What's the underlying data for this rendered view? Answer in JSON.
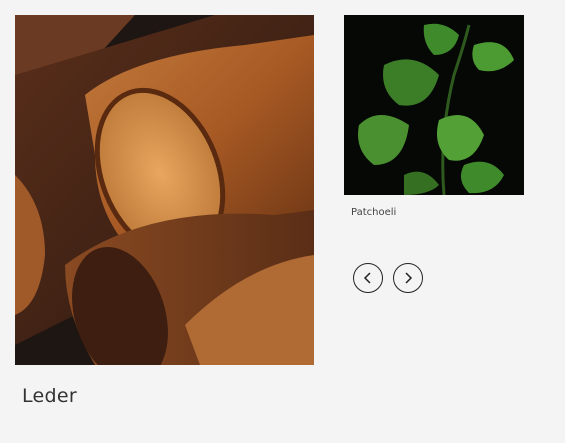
{
  "cards": [
    {
      "title": "Leder",
      "image": "leather-rolls-image"
    },
    {
      "title": "Patchoeli",
      "image": "patchouli-plant-image"
    }
  ],
  "carousel": {
    "prev_icon": "chevron-left-icon",
    "next_icon": "chevron-right-icon"
  }
}
